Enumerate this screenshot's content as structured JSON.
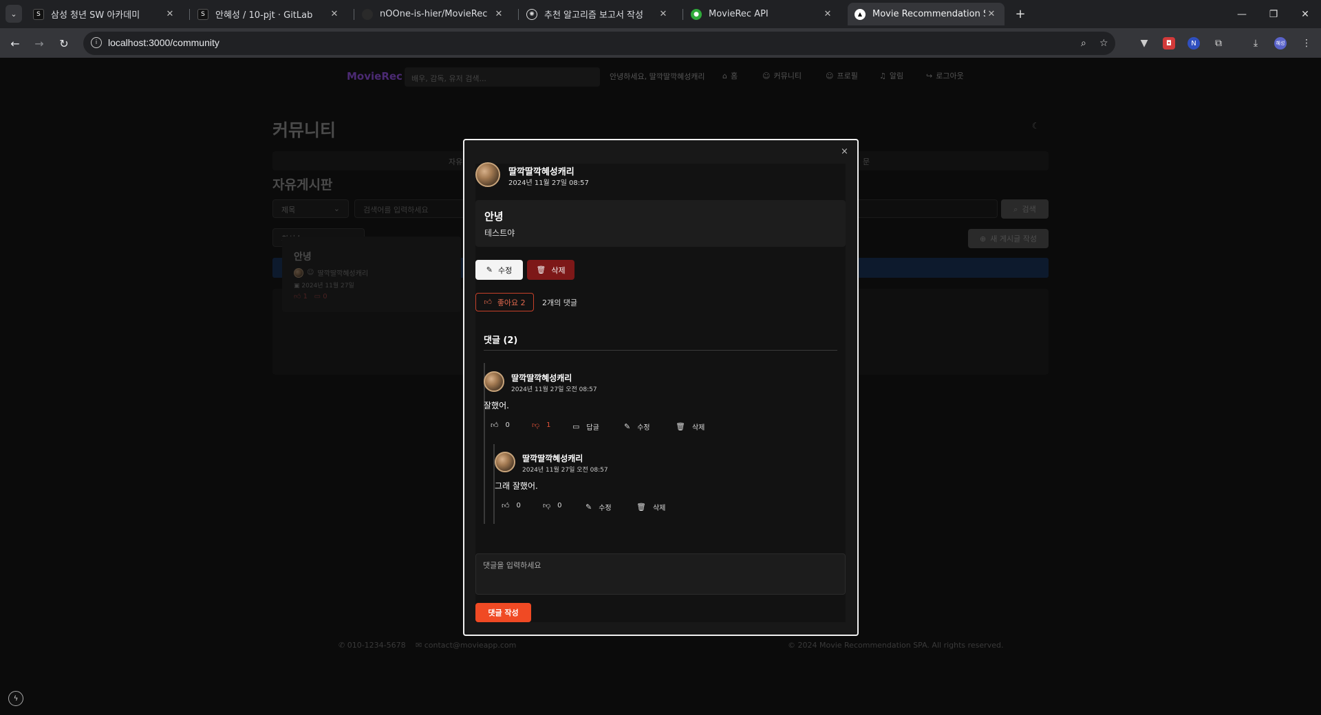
{
  "browser": {
    "tabs": [
      {
        "title": "삼성 청년 SW 아카데미",
        "favicon": "ssafy-icon"
      },
      {
        "title": "안혜성 / 10-pjt · GitLab",
        "favicon": "gitlab-icon"
      },
      {
        "title": "nOOne-is-hier/MovieRec",
        "favicon": "github-icon"
      },
      {
        "title": "추천 알고리즘 보고서 작성",
        "favicon": "openai-icon"
      },
      {
        "title": "MovieRec API",
        "favicon": "api-icon"
      },
      {
        "title": "Movie Recommendation SPA",
        "favicon": "vercel-icon"
      }
    ],
    "url": "localhost:3000/community",
    "profile_label": "혜성"
  },
  "site": {
    "logo": "MovieRec",
    "search_placeholder": "배우, 감독, 유저 검색...",
    "greeting": "안녕하세요, 딸깍딸깍혜성캐리",
    "nav": [
      "홈",
      "커뮤니티",
      "프로필",
      "알림",
      "로그아웃"
    ],
    "page_title": "커뮤니티",
    "subtab_left": "자유",
    "subtab_right": "문",
    "board_title": "자유게시판",
    "search_field_select": "제목",
    "search_input_placeholder": "검색어를 입력하세요",
    "search_button": "검색",
    "sort_select": "최신순",
    "new_post_button": "새 게시글 작성",
    "card": {
      "title": "안녕",
      "author": "딸깍딸깍혜성캐리",
      "date": "2024년 11월 27일",
      "likes": "1",
      "comments": "0"
    },
    "footer": {
      "phone": "010-1234-5678",
      "email": "contact@movieapp.com",
      "copyright": "© 2024 Movie Recommendation SPA. All rights reserved."
    }
  },
  "modal": {
    "close_label": "×",
    "post": {
      "author": "딸깍딸깍혜성캐리",
      "date": "2024년 11월 27일 08:57",
      "title": "안녕",
      "body": "테스트야",
      "edit_label": "수정",
      "delete_label": "삭제",
      "like_label": "좋아요 2",
      "comment_count": "2개의 댓글"
    },
    "comments_heading": "댓글 (2)",
    "comments": [
      {
        "author": "딸깍딸깍혜성캐리",
        "date": "2024년 11월 27일 오전 08:57",
        "text": "잘했어.",
        "likes": "0",
        "dislikes": "1",
        "reply_label": "답글",
        "edit_label": "수정",
        "delete_label": "삭제"
      },
      {
        "author": "딸깍딸깍혜성캐리",
        "date": "2024년 11월 27일 오전 08:57",
        "text": "그래 잘했어.",
        "likes": "0",
        "dislikes": "0",
        "edit_label": "수정",
        "delete_label": "삭제"
      }
    ],
    "comment_placeholder": "댓글을 입력하세요",
    "submit_label": "댓글 작성"
  },
  "colors": {
    "accent": "#f04a24",
    "danger": "#7d1818",
    "like_border": "#c7412a"
  }
}
